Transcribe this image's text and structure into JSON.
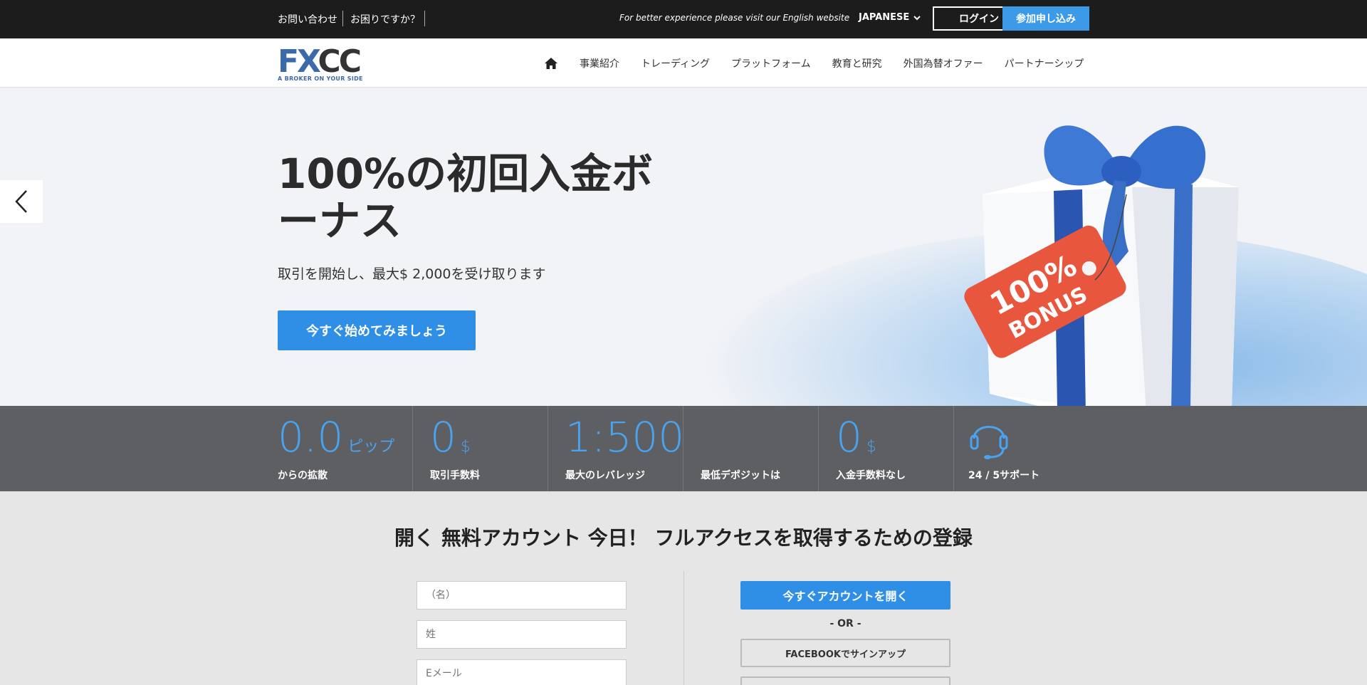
{
  "topbar": {
    "contact": "お問い合わせ",
    "help": "お困りですか？",
    "promo": "For better experience please visit our English website",
    "language": "JAPANESE",
    "login": "ログイン",
    "signup": "参加申し込み"
  },
  "header": {
    "logo_text_fx": "FX",
    "logo_text_cc": "CC",
    "logo_tagline": "A BROKER ON YOUR SIDE",
    "nav": [
      "事業紹介",
      "トレーディング",
      "プラットフォーム",
      "教育と研究",
      "外国為替オファー",
      "パートナーシップ"
    ]
  },
  "hero": {
    "title": "100%の初回入金ボーナス",
    "subtitle": "取引を開始し、最大$ 2,000を受け取ります",
    "cta": "今すぐ始めてみましょう",
    "tag_line1": "100%",
    "tag_line2": "BONUS"
  },
  "stats": [
    {
      "value": "0.0",
      "unit": "ピップ",
      "label": "からの拡散"
    },
    {
      "value": "0",
      "unit": "$",
      "label": "取引手数料"
    },
    {
      "value": "1:500",
      "unit": "",
      "label": "最大のレバレッジ"
    },
    {
      "value": "",
      "unit": "",
      "label": "最低デポジットは"
    },
    {
      "value": "0",
      "unit": "$",
      "label": "入金手数料なし"
    },
    {
      "value": "",
      "unit": "",
      "label": "24 / 5サポート"
    }
  ],
  "registration": {
    "title_pre": "開く",
    "title_bold": "無料アカウント",
    "title_post": "今日！ フルアクセスを取得するための登録",
    "first_name_placeholder": "（名）",
    "last_name_placeholder": "姓",
    "email_placeholder": "Eメール",
    "open_account": "今すぐアカウントを開く",
    "or": "- OR -",
    "facebook": "FACEBOOKでサインアップ"
  },
  "colors": {
    "accent": "#2f8fe6",
    "topbar": "#1c1c1c",
    "stats_bg": "#5e5f62",
    "stat_value": "#4aa3f0"
  }
}
